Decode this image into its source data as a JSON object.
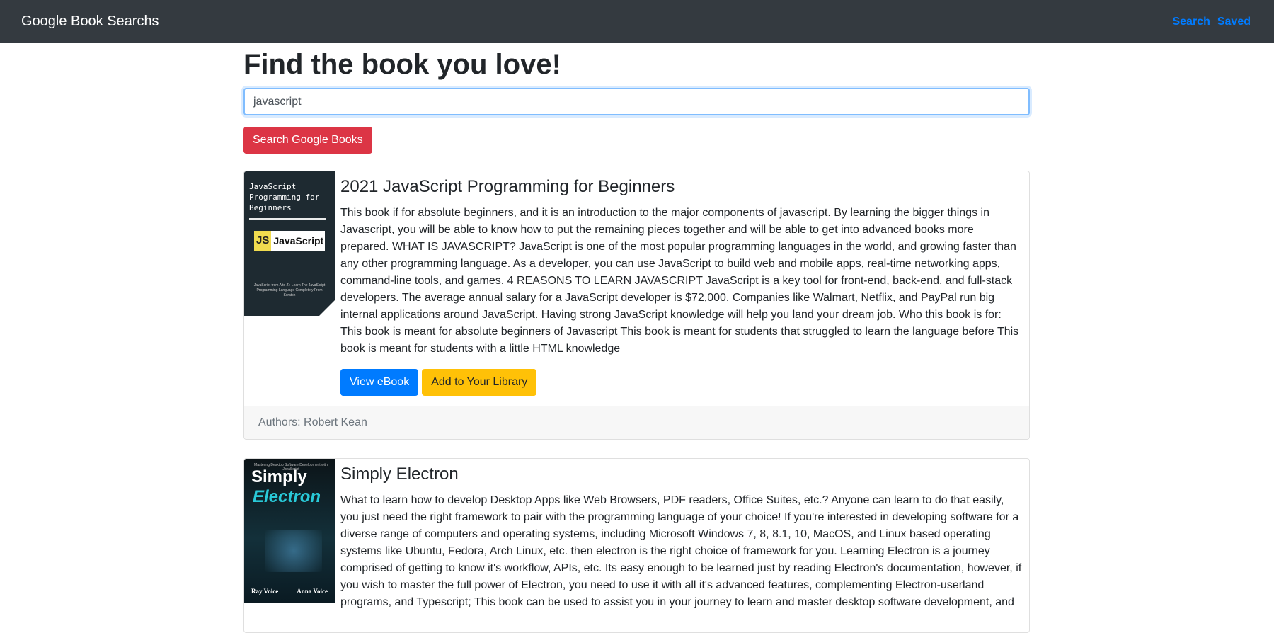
{
  "navbar": {
    "brand": "Google Book Searchs",
    "links": [
      "Search",
      "Saved"
    ]
  },
  "page": {
    "title": "Find the book you love!",
    "search_value": "javascript",
    "search_button": "Search Google Books"
  },
  "books": [
    {
      "title": "2021 JavaScript Programming for Beginners",
      "description": "This book if for absolute beginners, and it is an introduction to the major components of javascript. By learning the bigger things in Javascript, you will be able to know how to put the remaining pieces together and will be able to get into advanced books more prepared. WHAT IS JAVASCRIPT? JavaScript is one of the most popular programming languages in the world, and growing faster than any other programming language. As a developer, you can use JavaScript to build web and mobile apps, real-time networking apps, command-line tools, and games. 4 REASONS TO LEARN JAVASCRIPT JavaScript is a key tool for front-end, back-end, and full-stack developers. The average annual salary for a JavaScript developer is $72,000. Companies like Walmart, Netflix, and PayPal run big internal applications around JavaScript. Having strong JavaScript knowledge will help you land your dream job. Who this book is for: This book is meant for absolute beginners of Javascript This book is meant for students that struggled to learn the language before This book is meant for students with a little HTML knowledge",
      "view_button": "View eBook",
      "add_button": "Add to Your Library",
      "authors": "Authors: Robert Kean",
      "cover": {
        "title": "JavaScript Programming for Beginners",
        "logo_badge": "JS",
        "logo_text": "JavaScript",
        "subtitle": "JavaScript from A to Z : Learn The JavaScript Programming Language Completely From Scratch"
      }
    },
    {
      "title": "Simply Electron",
      "description": "What to learn how to develop Desktop Apps like Web Browsers, PDF readers, Office Suites, etc.? Anyone can learn to do that easily, you just need the right framework to pair with the programming language of your choice! If you're interested in developing software for a diverse range of computers and operating systems, including Microsoft Windows 7, 8, 8.1, 10, MacOS, and Linux based operating systems like Ubuntu, Fedora, Arch Linux, etc. then electron is the right choice of framework for you. Learning Electron is a journey comprised of getting to know it's workflow, APIs, etc. Its easy enough to be learned just by reading Electron's documentation, however, if you wish to master the full power of Electron, you need to use it with all it's advanced features, complementing Electron-userland programs, and Typescript; This book can be used to assist you in your journey to learn and master desktop software development, and",
      "cover": {
        "top_text": "Mastering Desktop Software Development with JavaScript",
        "title_line1": "Simply",
        "title_line2": "Electron",
        "author_left": "Ray Voice",
        "author_right": "Anna Voice"
      }
    }
  ]
}
